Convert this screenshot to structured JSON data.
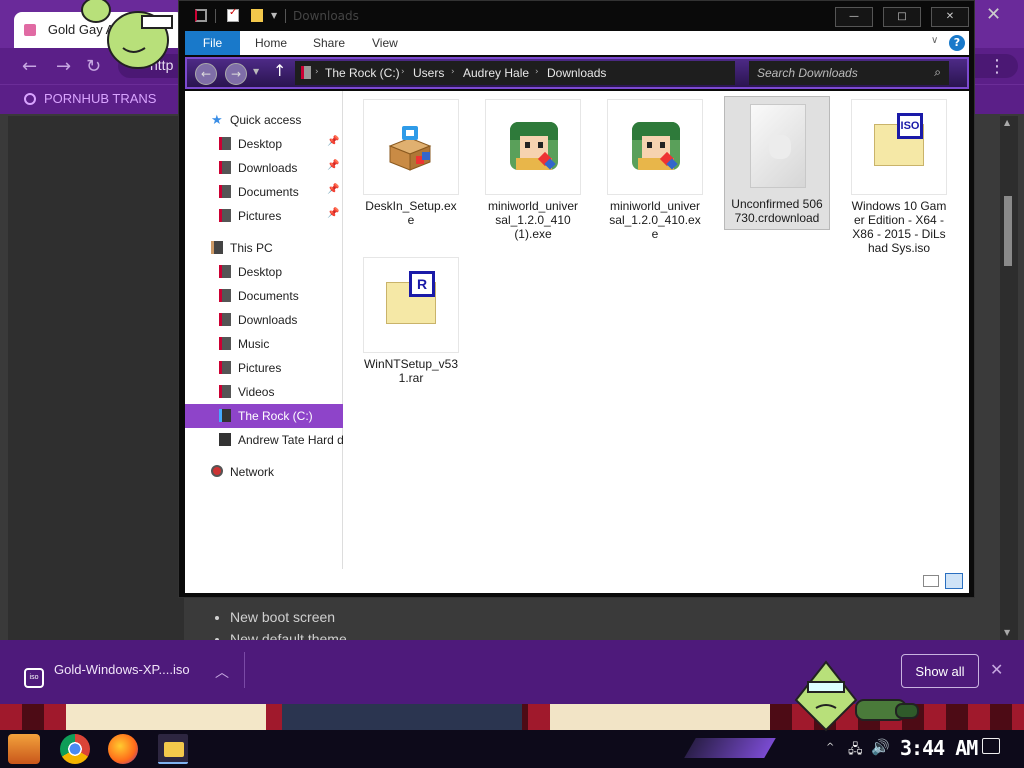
{
  "browser": {
    "tab_title": "Gold Gay Ar",
    "url": "http",
    "bookmark": "PORNHUB TRANS",
    "content_list": [
      "New boot screen",
      "New default theme"
    ]
  },
  "downloads_bar": {
    "file_name": "Gold-Windows-XP....iso",
    "show_all_label": "Show all"
  },
  "explorer": {
    "title": "Downloads",
    "ribbon_tabs": [
      "File",
      "Home",
      "Share",
      "View"
    ],
    "breadcrumb": [
      "The Rock (C:)",
      "Users",
      "Audrey Hale",
      "Downloads"
    ],
    "search_placeholder": "Search Downloads",
    "nav_pane": {
      "quick_access": "Quick access",
      "quick_items": [
        "Desktop",
        "Downloads",
        "Documents",
        "Pictures"
      ],
      "this_pc": "This PC",
      "pc_items": [
        "Desktop",
        "Documents",
        "Downloads",
        "Music",
        "Pictures",
        "Videos"
      ],
      "drive_c": "The Rock (C:)",
      "drive_d": "Andrew Tate Hard d",
      "network": "Network"
    },
    "files": [
      {
        "name": "DeskIn_Setup.exe",
        "icon": "setup-package-icon"
      },
      {
        "name": "miniworld_universal_1.2.0_410 (1).exe",
        "icon": "game-character-icon"
      },
      {
        "name": "miniworld_universal_1.2.0_410.exe",
        "icon": "game-character-icon"
      },
      {
        "name": "Unconfirmed 506730.crdownload",
        "icon": "blank-file-icon"
      },
      {
        "name": "Windows 10 Gamer Edition - X64 - X86 - 2015 - DiLshad Sys.iso",
        "icon": "iso-file-icon"
      },
      {
        "name": "WinNTSetup_v531.rar",
        "icon": "rar-archive-icon"
      }
    ]
  },
  "taskbar": {
    "clock": "3:44 AM"
  },
  "colors": {
    "accent_purple": "#8e44c9",
    "ribbon_file_blue": "#1979ca",
    "browser_purple": "#5b1f88"
  }
}
